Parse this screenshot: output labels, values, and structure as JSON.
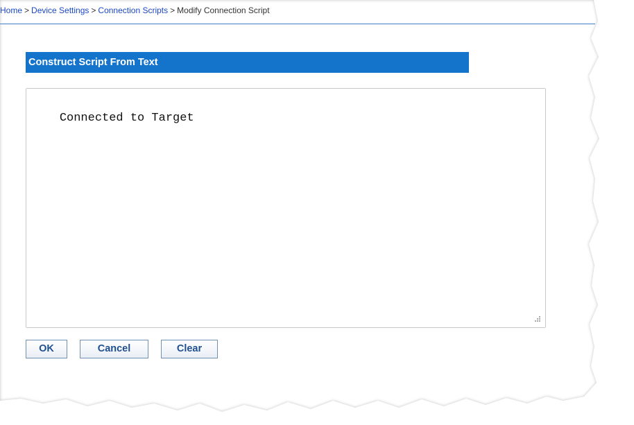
{
  "breadcrumb": {
    "items": [
      {
        "label": "Home",
        "link": true
      },
      {
        "label": "Device Settings",
        "link": true
      },
      {
        "label": "Connection Scripts",
        "link": true
      },
      {
        "label": "Modify Connection Script",
        "link": false
      }
    ],
    "separator": ">"
  },
  "section": {
    "title": "Construct Script From Text"
  },
  "script": {
    "value": "Connected to Target"
  },
  "buttons": {
    "ok": "OK",
    "cancel": "Cancel",
    "clear": "Clear"
  },
  "colors": {
    "accent": "#1474cc",
    "link": "#1a47c4",
    "rule": "#3f7cc2"
  }
}
